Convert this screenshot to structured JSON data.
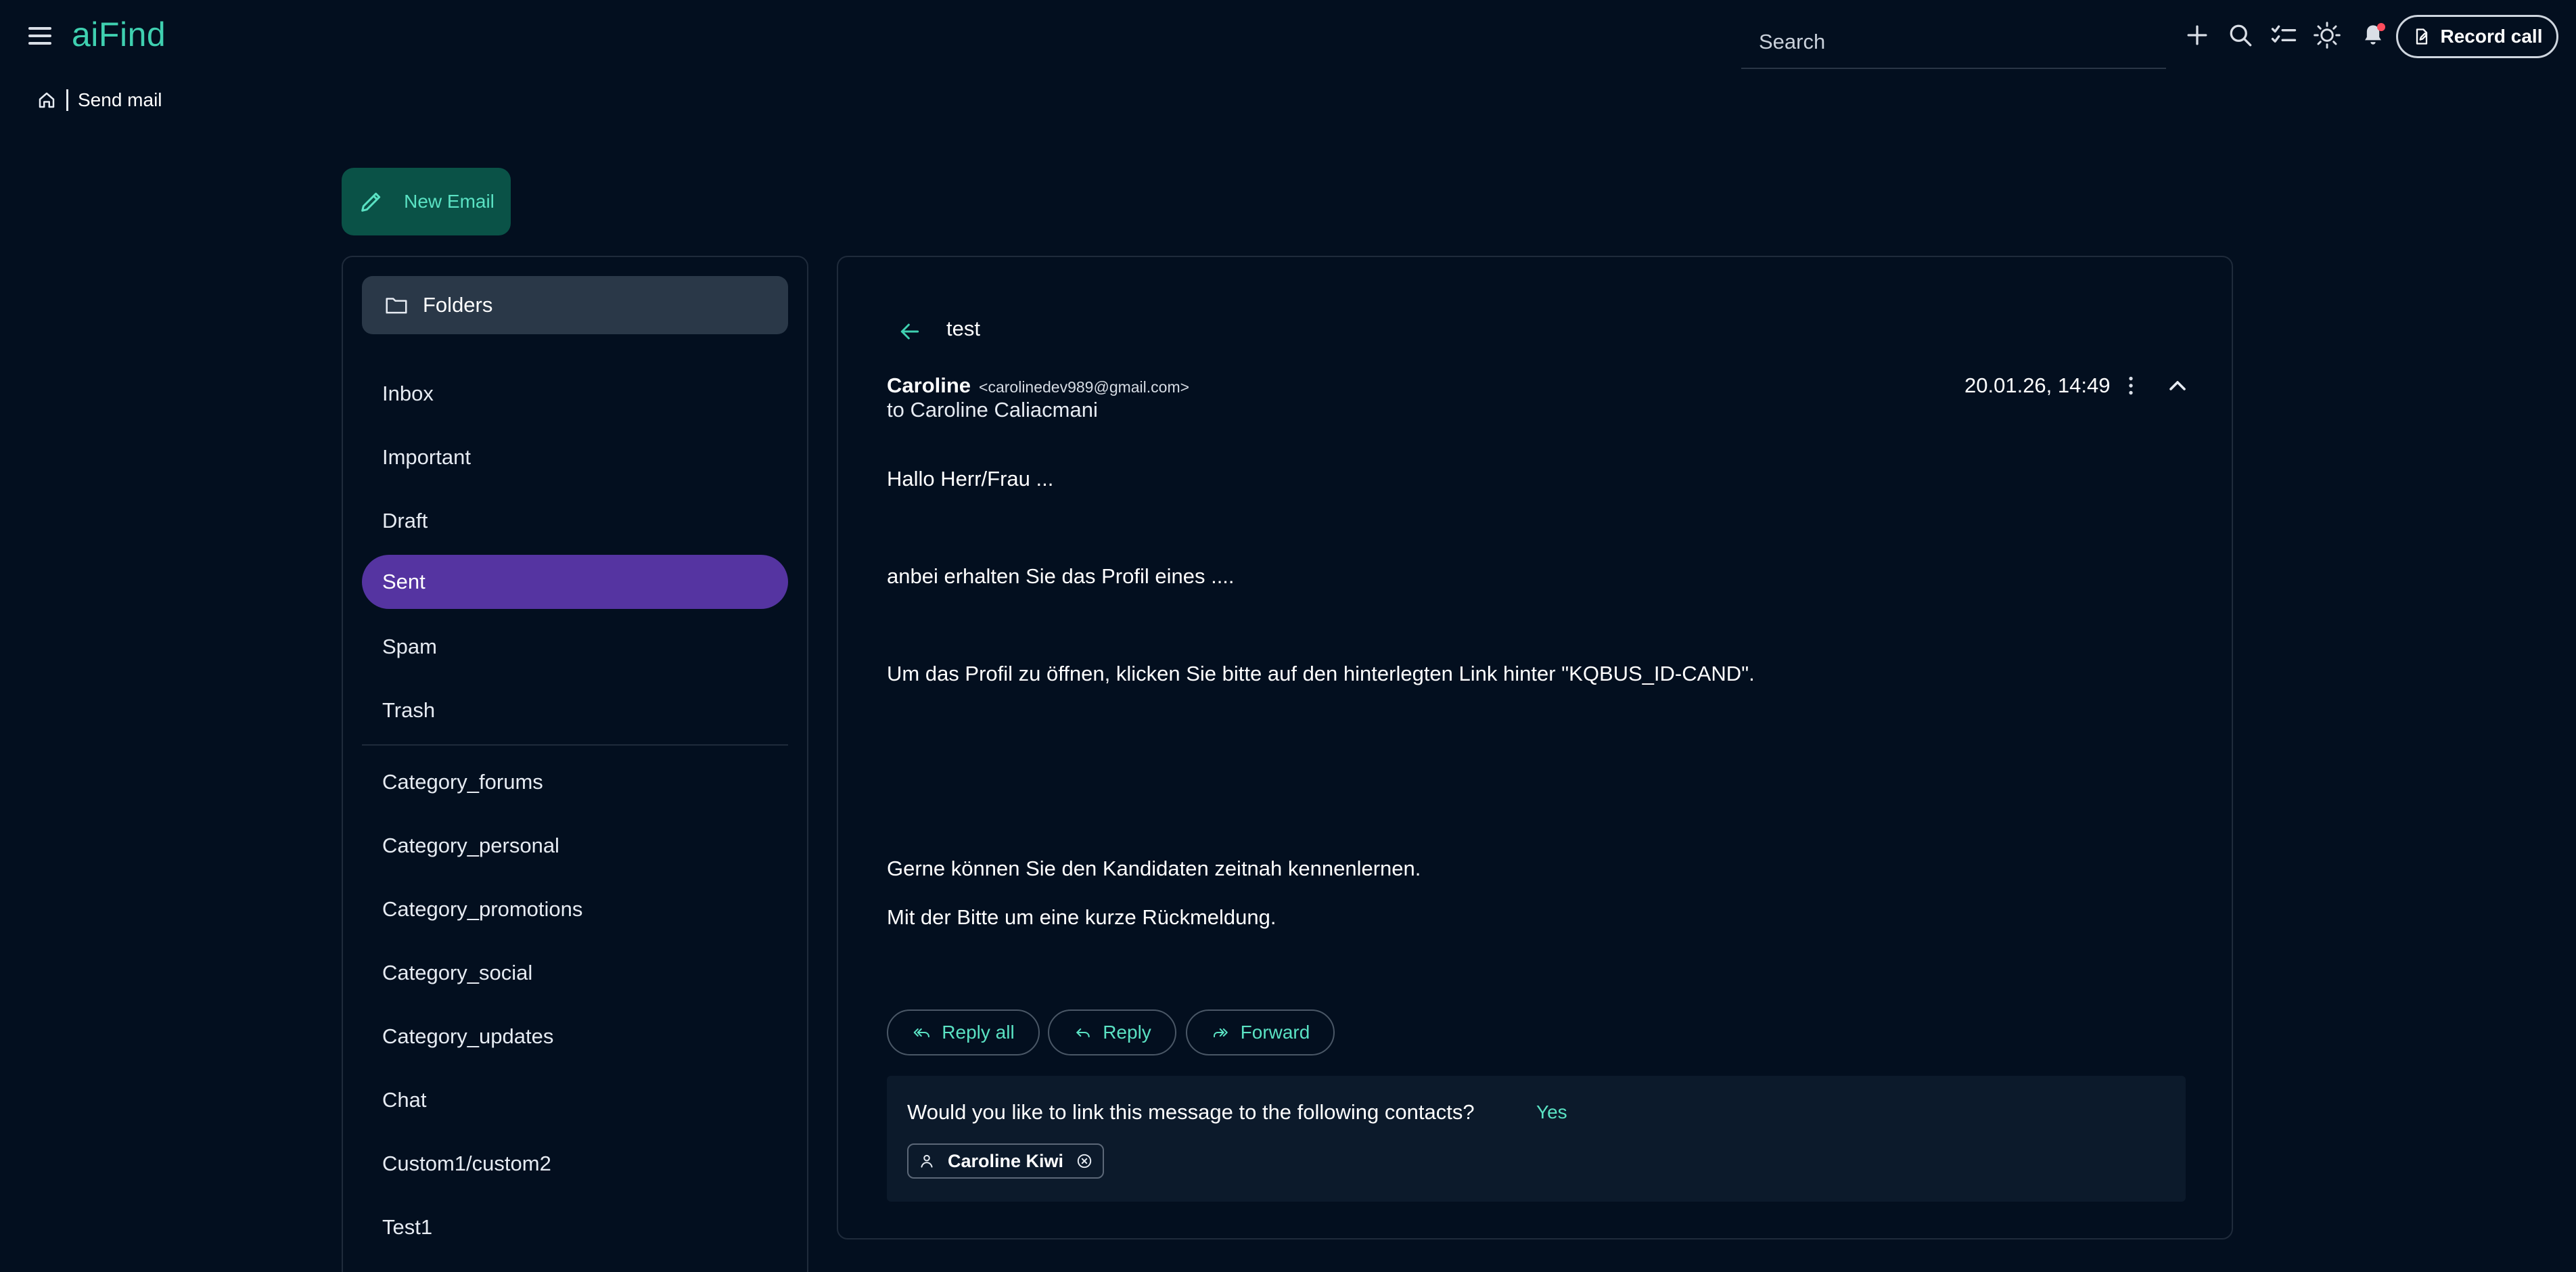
{
  "app": {
    "name": "aiFind"
  },
  "header": {
    "search_placeholder": "Search",
    "record_call_label": "Record call"
  },
  "breadcrumb": {
    "current": "Send mail"
  },
  "compose": {
    "new_email_label": "New Email"
  },
  "sidebar": {
    "folders_label": "Folders",
    "items": [
      {
        "label": "Inbox",
        "active": false
      },
      {
        "label": "Important",
        "active": false
      },
      {
        "label": "Draft",
        "active": false
      },
      {
        "label": "Sent",
        "active": true
      },
      {
        "label": "Spam",
        "active": false
      },
      {
        "label": "Trash",
        "active": false
      }
    ],
    "categories": [
      {
        "label": "Category_forums"
      },
      {
        "label": "Category_personal"
      },
      {
        "label": "Category_promotions"
      },
      {
        "label": "Category_social"
      },
      {
        "label": "Category_updates"
      },
      {
        "label": "Chat"
      },
      {
        "label": "Custom1/custom2"
      },
      {
        "label": "Test1"
      }
    ]
  },
  "email": {
    "subject": "test",
    "sender_name": "Caroline",
    "sender_email": "<carolinedev989@gmail.com>",
    "to": "to Caroline Caliacmani",
    "date": "20.01.26, 14:49",
    "body": [
      "Hallo Herr/Frau ...",
      "anbei erhalten Sie das Profil eines ....",
      "Um das Profil zu öffnen, klicken Sie bitte auf den hinterlegten Link hinter \"KQBUS_ID-CAND\".",
      "Gerne können Sie den Kandidaten zeitnah kennenlernen.",
      "Mit der Bitte um eine kurze Rückmeldung."
    ],
    "actions": {
      "reply_all": "Reply all",
      "reply": "Reply",
      "forward": "Forward"
    },
    "link_prompt": {
      "question": "Would you like to link this message to the following contacts?",
      "yes": "Yes",
      "contact": "Caroline Kiwi"
    }
  },
  "colors": {
    "background": "#030f1f",
    "accent": "#3fd0b0",
    "active_folder": "#5534a1",
    "new_email_bg": "#0a5247",
    "notification": "#ff4c5c"
  }
}
